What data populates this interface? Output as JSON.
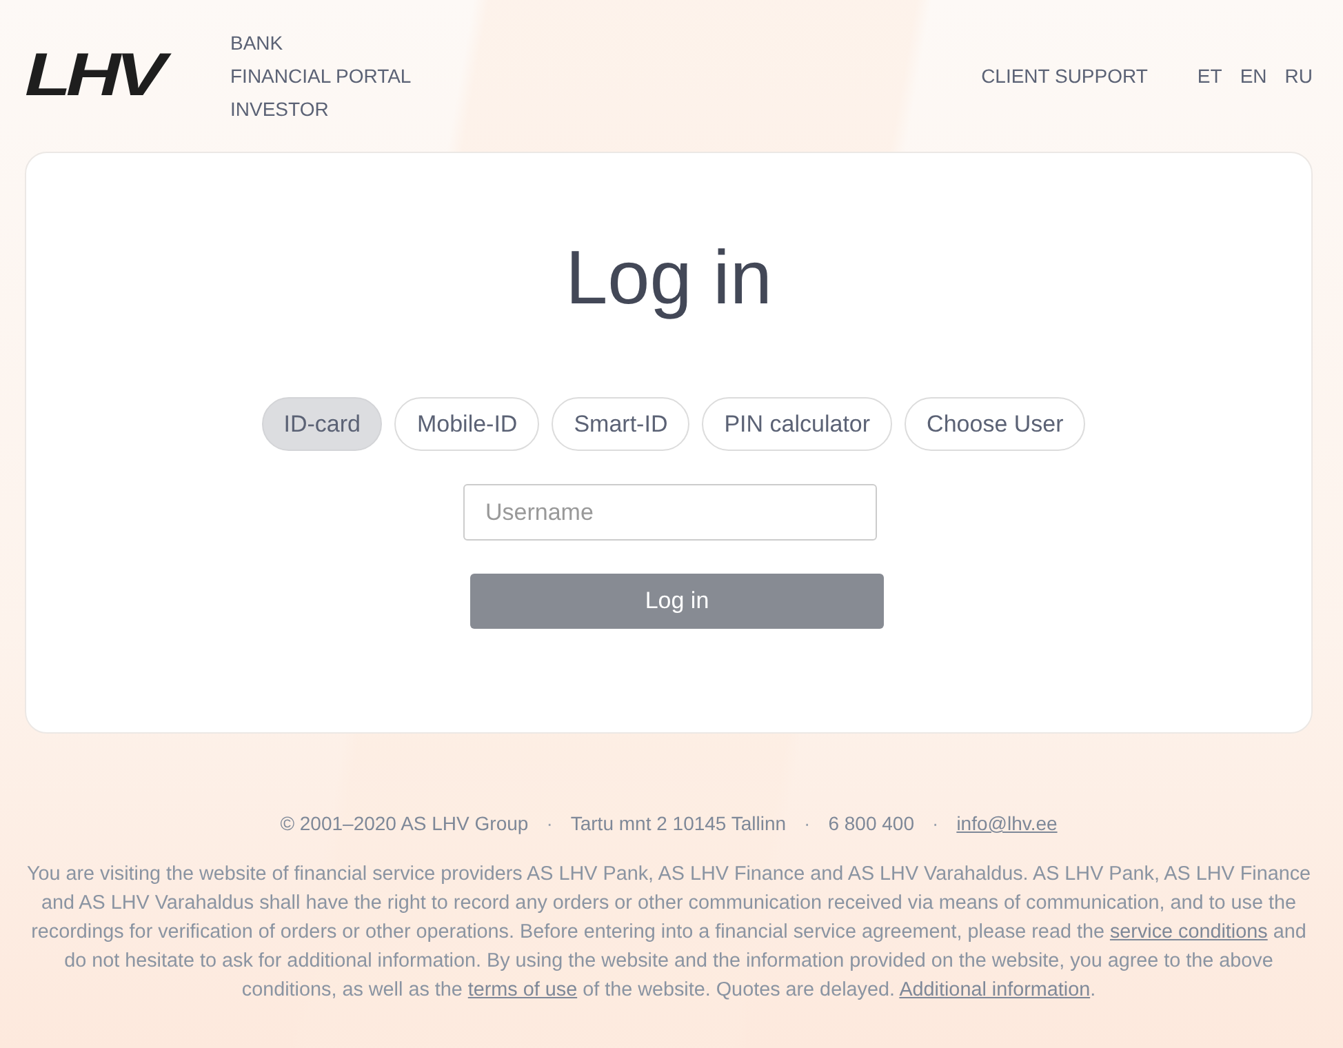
{
  "header": {
    "logo": "LHV",
    "nav": [
      "BANK",
      "FINANCIAL PORTAL",
      "INVESTOR"
    ],
    "support": "CLIENT SUPPORT",
    "languages": [
      "ET",
      "EN",
      "RU"
    ]
  },
  "login": {
    "title": "Log in",
    "tabs": [
      {
        "label": "ID-card",
        "selected": true
      },
      {
        "label": "Mobile-ID",
        "selected": false
      },
      {
        "label": "Smart-ID",
        "selected": false
      },
      {
        "label": "PIN calculator",
        "selected": false
      },
      {
        "label": "Choose User",
        "selected": false
      }
    ],
    "username": {
      "placeholder": "Username"
    },
    "submit": "Log in"
  },
  "footer": {
    "separator": "·",
    "contacts": [
      {
        "kind": "text",
        "text": "© 2001–2020 AS LHV Group"
      },
      {
        "kind": "text",
        "text": "Tartu mnt 2 10145 Tallinn"
      },
      {
        "kind": "text",
        "text": "6 800 400"
      },
      {
        "kind": "link",
        "text": "info@lhv.ee"
      }
    ],
    "disclaimer": [
      {
        "kind": "text",
        "text": "You are visiting the website of financial service providers AS LHV Pank, AS LHV Finance and AS LHV Varahaldus. AS LHV Pank, AS LHV Finance and AS LHV Varahaldus shall have the right to record any orders or other communication received via means of communication, and to use the recordings for verification of orders or other operations. Before entering into a financial service agreement, please read the "
      },
      {
        "kind": "link",
        "text": "service conditions"
      },
      {
        "kind": "text",
        "text": " and do not hesitate to ask for additional information. By using the website and the information provided on the website, you agree to the above conditions, as well as the "
      },
      {
        "kind": "link",
        "text": "terms of use"
      },
      {
        "kind": "text",
        "text": " of the website. Quotes are delayed. "
      },
      {
        "kind": "link",
        "text": "Additional information"
      },
      {
        "kind": "text",
        "text": "."
      }
    ]
  }
}
